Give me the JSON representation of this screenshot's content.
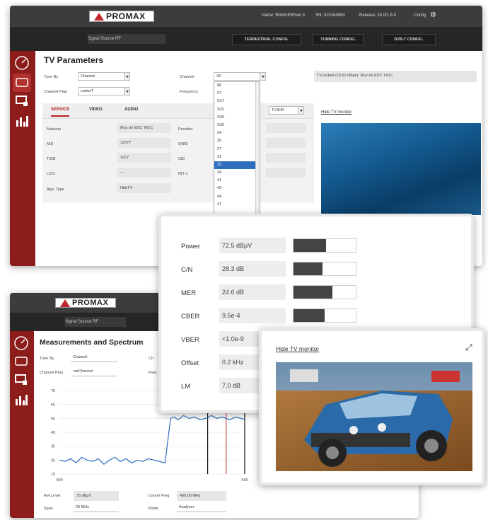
{
  "brand": "PROMAX",
  "top": {
    "header": {
      "name": "Name: RANGERNeo 3",
      "sn": "SN: 010164590",
      "release": "Release: 24.0/1.6.0",
      "config": "Config"
    },
    "signal_source": "Signal Source RF",
    "tabs": [
      "TERRESTRIAL CONFIG.",
      "TUNNING CONFIG.",
      "DVB-T CONFIG."
    ],
    "title": "TV Parameters",
    "tune_by_label": "Tune By",
    "tune_by_value": "Channel",
    "channel_plan_label": "Channel Plan",
    "channel_plan_value": "carlosT",
    "channel_label": "Channel",
    "channel_value": "33",
    "frequency_label": "Frequency",
    "ts_status": "TS locked (19.91 Mbps): Mux de EDC TA1C",
    "channel_options": [
      "06",
      "07",
      "S17",
      "S22",
      "S30",
      "S32",
      "24",
      "26",
      "27",
      "31",
      "33",
      "34",
      "41",
      "43",
      "44",
      "47"
    ],
    "selected_channel": "33",
    "service_tabs": [
      "SERVICE",
      "VIDEO",
      "AUDIO"
    ],
    "service_name": "TV3HD",
    "hide_monitor": "Hide TV monitor",
    "rows_left": [
      {
        "label": "Network",
        "value": "Mux de EDC TA1C"
      },
      {
        "label": "NID",
        "value": "12577"
      },
      {
        "label": "TSID",
        "value": "1007"
      },
      {
        "label": "LCN",
        "value": "---"
      },
      {
        "label": "App. Type",
        "value": "HbbTV"
      }
    ],
    "rows_right": [
      "Provider",
      "ONID",
      "SID",
      "NIT v."
    ]
  },
  "measurements": [
    {
      "label": "Power",
      "value": "72.5 dBµV",
      "level": 0.52
    },
    {
      "label": "C/N",
      "value": "28.3 dB",
      "level": 0.47
    },
    {
      "label": "MER",
      "value": "24.6 dB",
      "level": 0.62
    },
    {
      "label": "CBER",
      "value": "9.5e-4",
      "level": 0.5
    },
    {
      "label": "VBER",
      "value": "<1.0e-9",
      "level": 0
    },
    {
      "label": "Offset",
      "value": "0.2 kHz",
      "level": 0
    },
    {
      "label": "LM",
      "value": "7.0 dB",
      "level": 0
    }
  ],
  "monitor": {
    "hide_label": "Hide TV monitor"
  },
  "bottom": {
    "signal_source": "Signal Source RF",
    "title": "Measurements and Spectrum",
    "tune_by_label": "Tune By",
    "tune_by_value": "Channel",
    "channel_plan_label": "Channel Plan",
    "channel_plan_value": "carChannel",
    "cut_label_1": "Ch",
    "cut_label_2": "Freq",
    "ref_level_label": "Ref.Level",
    "ref_level_value": "75 dBµV",
    "center_freq_label": "Center Freq",
    "center_freq_value": "490.00 MHz",
    "span_label": "Span",
    "span_value": "20 MHz",
    "mode_label": "Mode",
    "mode_value": "Analyzer"
  },
  "chart_data": {
    "type": "line",
    "x_ticks": [
      "400",
      "500"
    ],
    "y_ticks": [
      "75",
      "65",
      "55",
      "45",
      "35",
      "25",
      "15"
    ],
    "marker_label": "490",
    "ylim": [
      15,
      75
    ],
    "xlim": [
      400,
      500
    ],
    "marker": 490,
    "channel_edges": [
      480,
      500
    ],
    "series": [
      {
        "x": [
          400,
          403,
          406,
          409,
          412,
          415,
          418,
          421,
          424,
          427,
          430,
          433,
          436,
          439,
          442,
          445,
          448,
          451,
          454,
          457,
          460,
          462,
          464,
          467,
          470,
          473,
          476,
          479,
          482,
          485,
          488,
          490,
          492,
          495,
          498,
          500
        ],
        "y": [
          25,
          24,
          26,
          23,
          27,
          25,
          24,
          26,
          22,
          25,
          27,
          24,
          26,
          23,
          25,
          24,
          26,
          25,
          24,
          23,
          55,
          56,
          54,
          57,
          55,
          56,
          54,
          55,
          57,
          55,
          56,
          55,
          54,
          56,
          55,
          54
        ]
      }
    ],
    "colors": {
      "line": "#2f6fc0",
      "edges": "#111111",
      "marker": "#c1272d"
    }
  }
}
